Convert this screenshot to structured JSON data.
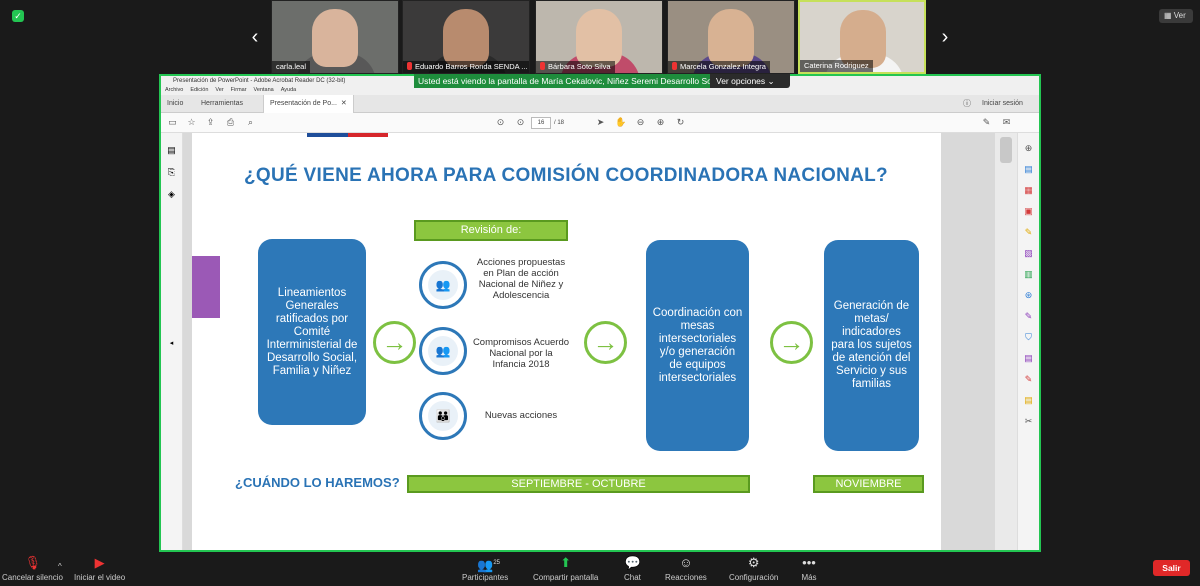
{
  "gallery": {
    "view_label": "Ver",
    "participants": [
      {
        "name": "carla.leal",
        "muted": false,
        "bg": "#6c6e6b",
        "face": "#d9b49c",
        "body": "#585858"
      },
      {
        "name": "Eduardo Barros Ronda SENDA ...",
        "muted": true,
        "bg": "#3b3a3a",
        "face": "#b88b6e",
        "body": "#2a2a2a"
      },
      {
        "name": "Bárbara Soto Silva",
        "muted": true,
        "bg": "#bdb7ad",
        "face": "#e2c0a5",
        "body": "#c04c6a"
      },
      {
        "name": "Marcela Gonzalez Integra",
        "muted": true,
        "bg": "#9a8f82",
        "face": "#d8b293",
        "body": "#5c4a8a"
      },
      {
        "name": "Caterina Rodriguez",
        "muted": false,
        "bg": "#d8d4cc",
        "face": "#d5ad8d",
        "body": "#f4f4f4"
      }
    ]
  },
  "share": {
    "banner": "Usted está viendo la pantalla de María Cekalovic, Niñez Seremi Desarrollo Social",
    "options_label": "Ver opciones"
  },
  "reader": {
    "title": "Presentación de PowerPoint - Adobe Acrobat Reader DC (32-bit)",
    "menu": [
      "Archivo",
      "Edición",
      "Ver",
      "Firmar",
      "Ventana",
      "Ayuda"
    ],
    "tabs": [
      "Inicio",
      "Herramientas",
      "Presentación de Po..."
    ],
    "signin": "Iniciar sesión",
    "page_current": "16",
    "page_total": "/ 18"
  },
  "slide": {
    "title": "¿QUÉ VIENE AHORA PARA COMISIÓN COORDINADORA NACIONAL?",
    "box1": "Lineamientos Generales ratificados por Comité Interministerial de Desarrollo Social, Familia y Niñez",
    "revision_label": "Revisión de:",
    "rev_items": [
      "Acciones propuestas en Plan de acción Nacional de Niñez y Adolescencia",
      "Compromisos Acuerdo Nacional por la Infancia 2018",
      "Nuevas acciones"
    ],
    "box2": "Coordinación con mesas intersectoriales y/o generación de equipos intersectoriales",
    "box3": "Generación de metas/ indicadores para los sujetos de atención del Servicio y sus familias",
    "cuando": "¿CUÁNDO LO HAREMOS?",
    "period1": "SEPTIEMBRE - OCTUBRE",
    "period2": "NOVIEMBRE"
  },
  "bottom": {
    "unmute": "Cancelar silencio",
    "video": "Iniciar el video",
    "participants": "Participantes",
    "participants_count": "25",
    "share": "Compartir pantalla",
    "chat": "Chat",
    "reactions": "Reacciones",
    "settings": "Configuración",
    "more": "Más",
    "leave": "Salir"
  },
  "colors": {
    "accent_green": "#23c552",
    "slide_blue": "#2d78b8",
    "slide_green": "#8cc63f",
    "leave_red": "#e02828"
  }
}
